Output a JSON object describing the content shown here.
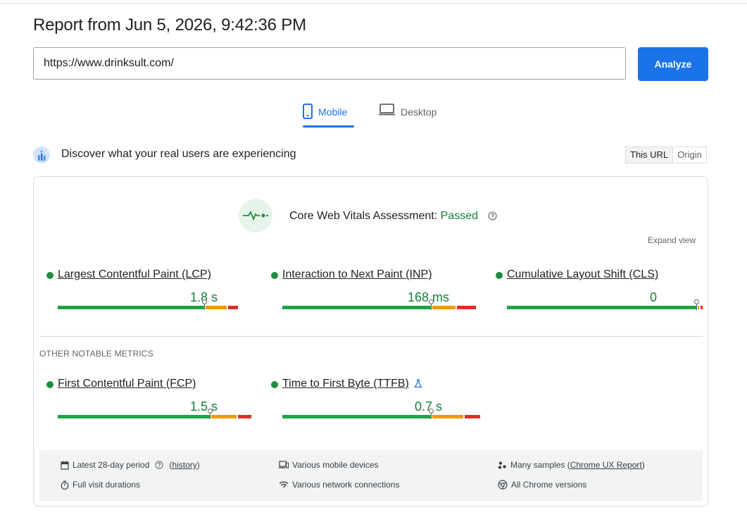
{
  "page": {
    "title": "Report from Jun 5, 2026, 9:42:36 PM",
    "url_value": "https://www.drinksult.com/",
    "analyze_label": "Analyze"
  },
  "tabs": [
    {
      "label": "Mobile",
      "icon": "phone-icon",
      "active": true
    },
    {
      "label": "Desktop",
      "icon": "laptop-icon",
      "active": false
    }
  ],
  "crux": {
    "heading": "Discover what your real users are experiencing",
    "toggle": {
      "this_url": "This URL",
      "origin": "Origin",
      "selected": "This URL"
    }
  },
  "assessment": {
    "label": "Core Web Vitals Assessment:",
    "status": "Passed",
    "expand_label": "Expand view"
  },
  "core_metrics": [
    {
      "name": "Largest Contentful Paint (LCP)",
      "value": "1.8 s",
      "status_color": "#1e8e3e",
      "distribution": [
        0.75,
        0.11,
        0.05
      ]
    },
    {
      "name": "Interaction to Next Paint (INP)",
      "value": "168 ms",
      "status_color": "#1e8e3e",
      "distribution": [
        0.76,
        0.12,
        0.1
      ]
    },
    {
      "name": "Cumulative Layout Shift (CLS)",
      "value": "0",
      "status_color": "#1e8e3e",
      "distribution": [
        0.97,
        0.01,
        0.01
      ]
    }
  ],
  "other_label": "OTHER NOTABLE METRICS",
  "other_metrics": [
    {
      "name": "First Contentful Paint (FCP)",
      "value": "1.5 s",
      "status_color": "#1e8e3e",
      "distribution": [
        0.78,
        0.13,
        0.07
      ]
    },
    {
      "name": "Time to First Byte (TTFB)",
      "value": "0.7 s",
      "status_color": "#1e8e3e",
      "distribution": [
        0.76,
        0.16,
        0.08
      ],
      "experimental_icon": "flask-icon"
    }
  ],
  "footer": {
    "period": "Latest 28-day period",
    "history_link": "history",
    "durations": "Full visit durations",
    "devices": "Various mobile devices",
    "network": "Various network connections",
    "samples_prefix": "Many samples (",
    "samples_link": "Chrome UX Report",
    "samples_suffix": ")",
    "chrome": "All Chrome versions"
  },
  "colors": {
    "accent": "#1a73e8",
    "good": "#1ea446",
    "needs_improvement": "#f29900",
    "poor": "#d93025"
  }
}
